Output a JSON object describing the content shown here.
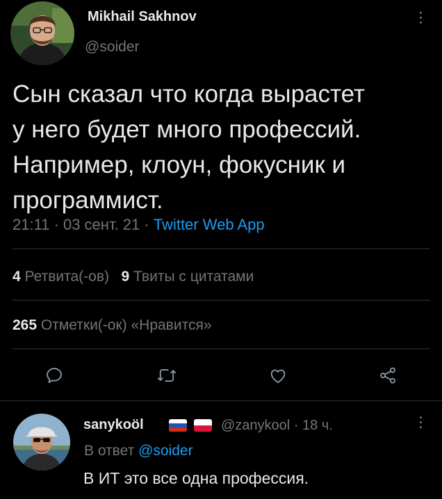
{
  "tweet": {
    "author_name": "Mikhail Sakhnov",
    "author_handle": "@soider",
    "text_lines": [
      "Сын сказал что когда вырастет",
      "у него будет много профессий.",
      "Например, клоун, фокусник и",
      "программист."
    ],
    "timestamp": "21:11 · 03 сент. 21 · ",
    "source": "Twitter Web App",
    "retweets_count": "4",
    "retweets_label": "Ретвита(-ов)",
    "quotes_count": "9",
    "quotes_label": "Твиты с цитатами",
    "likes_count": "265",
    "likes_label": "Отметки(-ок) «Нравится»"
  },
  "actions": {
    "icons": [
      "reply-icon",
      "retweet-icon",
      "like-icon",
      "share-icon"
    ]
  },
  "reply": {
    "author_name": "sanykoöl",
    "flags": [
      "russia-flag",
      "poland-flag"
    ],
    "handle_time": "@zanykool · 18 ч.",
    "reply_to_prefix": "В ответ ",
    "reply_to_mention": "@soider",
    "text": "В ИТ это все одна профессия."
  },
  "colors": {
    "background": "#000000",
    "text_primary": "#e7e9ea",
    "text_secondary": "#71767b",
    "accent": "#1d9bf0",
    "divider": "#2f3336"
  }
}
